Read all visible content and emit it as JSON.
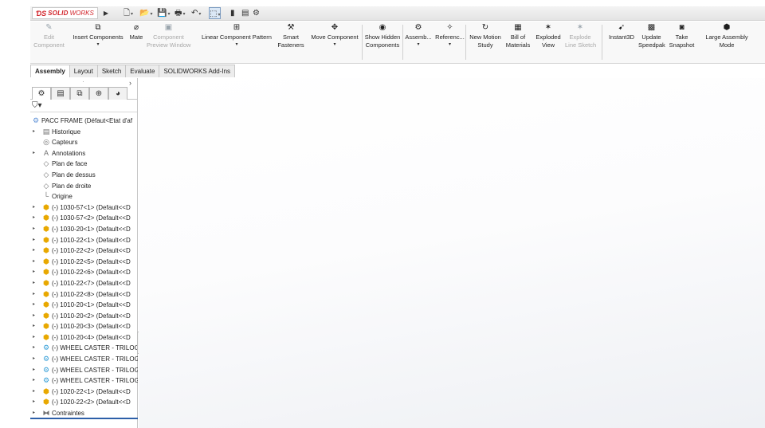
{
  "logo": {
    "ds": "ƊS",
    "sw": "SOLID",
    "works": "WORKS"
  },
  "titlebar": {
    "menu_arrow": "▶",
    "quick_access": [
      {
        "name": "new-document-icon",
        "glyph": "🗋"
      },
      {
        "name": "open-icon",
        "glyph": "📂"
      },
      {
        "name": "save-icon",
        "glyph": "💾"
      },
      {
        "name": "print-icon",
        "glyph": "🖶"
      },
      {
        "name": "undo-icon",
        "glyph": "↶"
      },
      {
        "name": "select-icon",
        "glyph": "⬚"
      },
      {
        "name": "rebuild-icon",
        "glyph": "▮"
      },
      {
        "name": "file-properties-icon",
        "glyph": "▤"
      },
      {
        "name": "options-icon",
        "glyph": "⚙"
      }
    ]
  },
  "commands": [
    {
      "id": "edit-component",
      "lines": [
        "Edit",
        "Component"
      ],
      "icon": "edit-component-icon",
      "glyph": "✎",
      "disabled": true,
      "caret": false
    },
    {
      "id": "insert-components",
      "lines": [
        "Insert Components"
      ],
      "icon": "insert-components-icon",
      "glyph": "⧉",
      "disabled": false,
      "caret": true
    },
    {
      "id": "mate",
      "lines": [
        "Mate"
      ],
      "icon": "mate-icon",
      "glyph": "⌀",
      "disabled": false,
      "caret": false
    },
    {
      "id": "component-preview",
      "lines": [
        "Component",
        "Preview Window"
      ],
      "icon": "component-preview-icon",
      "glyph": "▣",
      "disabled": true,
      "caret": false
    },
    {
      "id": "linear-pattern",
      "lines": [
        "Linear Component Pattern"
      ],
      "icon": "linear-pattern-icon",
      "glyph": "⊞",
      "disabled": false,
      "caret": true
    },
    {
      "id": "smart-fasteners",
      "lines": [
        "Smart",
        "Fasteners"
      ],
      "icon": "smart-fasteners-icon",
      "glyph": "⚒",
      "disabled": false,
      "caret": false
    },
    {
      "id": "move-component",
      "lines": [
        "Move Component"
      ],
      "icon": "move-component-icon",
      "glyph": "✥",
      "disabled": false,
      "caret": true
    },
    {
      "id": "show-hidden",
      "lines": [
        "Show Hidden",
        "Components"
      ],
      "icon": "show-hidden-icon",
      "glyph": "◉",
      "disabled": false,
      "caret": false
    },
    {
      "id": "assembly-features",
      "lines": [
        "Assemb..."
      ],
      "icon": "assembly-features-icon",
      "glyph": "⚙",
      "disabled": false,
      "caret": true
    },
    {
      "id": "reference-geometry",
      "lines": [
        "Referenc..."
      ],
      "icon": "reference-geometry-icon",
      "glyph": "✧",
      "disabled": false,
      "caret": true
    },
    {
      "id": "new-motion-study",
      "lines": [
        "New Motion",
        "Study"
      ],
      "icon": "motion-study-icon",
      "glyph": "↻",
      "disabled": false,
      "caret": false
    },
    {
      "id": "bill-of-materials",
      "lines": [
        "Bill of",
        "Materials"
      ],
      "icon": "bom-icon",
      "glyph": "▦",
      "disabled": false,
      "caret": false
    },
    {
      "id": "exploded-view",
      "lines": [
        "Exploded",
        "View"
      ],
      "icon": "exploded-view-icon",
      "glyph": "✶",
      "disabled": false,
      "caret": false
    },
    {
      "id": "explode-line-sketch",
      "lines": [
        "Explode",
        "Line Sketch"
      ],
      "icon": "explode-line-sketch-icon",
      "glyph": "✶",
      "disabled": true,
      "caret": false
    },
    {
      "id": "instant3d",
      "lines": [
        "Instant3D"
      ],
      "icon": "instant3d-icon",
      "glyph": "➹",
      "disabled": false,
      "caret": false
    },
    {
      "id": "update-speedpak",
      "lines": [
        "Update",
        "Speedpak"
      ],
      "icon": "speedpak-icon",
      "glyph": "▩",
      "disabled": false,
      "caret": false
    },
    {
      "id": "take-snapshot",
      "lines": [
        "Take",
        "Snapshot"
      ],
      "icon": "snapshot-icon",
      "glyph": "◙",
      "disabled": false,
      "caret": false
    },
    {
      "id": "large-assembly-mode",
      "lines": [
        "Large Assembly",
        "Mode"
      ],
      "icon": "large-assembly-icon",
      "glyph": "⬢",
      "disabled": false,
      "caret": false
    }
  ],
  "tabs": [
    {
      "label": "Assembly",
      "active": true
    },
    {
      "label": "Layout",
      "active": false
    },
    {
      "label": "Sketch",
      "active": false
    },
    {
      "label": "Evaluate",
      "active": false
    },
    {
      "label": "SOLIDWORKS Add-Ins",
      "active": false
    }
  ],
  "feature_manager": {
    "grip": "⠂",
    "panel_tabs": [
      {
        "name": "featuremanager-tab",
        "glyph": "⚙",
        "active": true
      },
      {
        "name": "propertymanager-tab",
        "glyph": "▤",
        "active": false
      },
      {
        "name": "configurationmanager-tab",
        "glyph": "⧉",
        "active": false
      },
      {
        "name": "dimxpert-tab",
        "glyph": "⊕",
        "active": false
      },
      {
        "name": "display-manager-tab",
        "glyph": "◕",
        "active": false
      }
    ],
    "more": "›",
    "filter": "⛉▾",
    "tree": [
      {
        "label": "PACC FRAME  (Défaut<Etat d'af",
        "icon": "assembly-icon",
        "glyph": "⚙",
        "cls": "ic-asm",
        "level": 0,
        "expander": false
      },
      {
        "label": "Historique",
        "icon": "history-icon",
        "glyph": "▤",
        "cls": "ic-plane",
        "level": 1,
        "expander": true
      },
      {
        "label": "Capteurs",
        "icon": "sensors-icon",
        "glyph": "◎",
        "cls": "ic-plane",
        "level": 1,
        "expander": false
      },
      {
        "label": "Annotations",
        "icon": "annotations-icon",
        "glyph": "A",
        "cls": "ic-plane",
        "level": 1,
        "expander": true
      },
      {
        "label": "Plan de face",
        "icon": "plane-icon",
        "glyph": "◇",
        "cls": "ic-plane",
        "level": 1,
        "expander": false
      },
      {
        "label": "Plan de dessus",
        "icon": "plane-icon",
        "glyph": "◇",
        "cls": "ic-plane",
        "level": 1,
        "expander": false
      },
      {
        "label": "Plan de droite",
        "icon": "plane-icon",
        "glyph": "◇",
        "cls": "ic-plane",
        "level": 1,
        "expander": false
      },
      {
        "label": "Origine",
        "icon": "origin-icon",
        "glyph": "└",
        "cls": "ic-plane",
        "level": 1,
        "expander": false
      },
      {
        "label": "(-) 1030-57<1> (Default<<D",
        "icon": "part-icon",
        "glyph": "⬢",
        "cls": "ic-part",
        "level": 1,
        "expander": true
      },
      {
        "label": "(-) 1030-57<2> (Default<<D",
        "icon": "part-icon",
        "glyph": "⬢",
        "cls": "ic-part",
        "level": 1,
        "expander": true
      },
      {
        "label": "(-) 1030-20<1> (Default<<D",
        "icon": "part-icon",
        "glyph": "⬢",
        "cls": "ic-part",
        "level": 1,
        "expander": true
      },
      {
        "label": "(-) 1010-22<1> (Default<<D",
        "icon": "part-icon",
        "glyph": "⬢",
        "cls": "ic-part",
        "level": 1,
        "expander": true
      },
      {
        "label": "(-) 1010-22<2> (Default<<D",
        "icon": "part-icon",
        "glyph": "⬢",
        "cls": "ic-part",
        "level": 1,
        "expander": true
      },
      {
        "label": "(-) 1010-22<5> (Default<<D",
        "icon": "part-icon",
        "glyph": "⬢",
        "cls": "ic-part",
        "level": 1,
        "expander": true
      },
      {
        "label": "(-) 1010-22<6> (Default<<D",
        "icon": "part-icon",
        "glyph": "⬢",
        "cls": "ic-part",
        "level": 1,
        "expander": true
      },
      {
        "label": "(-) 1010-22<7> (Default<<D",
        "icon": "part-icon",
        "glyph": "⬢",
        "cls": "ic-part",
        "level": 1,
        "expander": true
      },
      {
        "label": "(-) 1010-22<8> (Default<<D",
        "icon": "part-icon",
        "glyph": "⬢",
        "cls": "ic-part",
        "level": 1,
        "expander": true
      },
      {
        "label": "(-) 1010-20<1> (Default<<D",
        "icon": "part-icon",
        "glyph": "⬢",
        "cls": "ic-part",
        "level": 1,
        "expander": true
      },
      {
        "label": "(-) 1010-20<2> (Default<<D",
        "icon": "part-icon",
        "glyph": "⬢",
        "cls": "ic-part",
        "level": 1,
        "expander": true
      },
      {
        "label": "(-) 1010-20<3> (Default<<D",
        "icon": "part-icon",
        "glyph": "⬢",
        "cls": "ic-part",
        "level": 1,
        "expander": true
      },
      {
        "label": "(-) 1010-20<4> (Default<<D",
        "icon": "part-icon",
        "glyph": "⬢",
        "cls": "ic-part",
        "level": 1,
        "expander": true
      },
      {
        "label": "(-) WHEEL CASTER - TRILOG",
        "icon": "subassembly-icon",
        "glyph": "⚙",
        "cls": "ic-wheel",
        "level": 1,
        "expander": true
      },
      {
        "label": "(-) WHEEL CASTER - TRILOG",
        "icon": "subassembly-icon",
        "glyph": "⚙",
        "cls": "ic-wheel",
        "level": 1,
        "expander": true
      },
      {
        "label": "(-) WHEEL CASTER - TRILOG",
        "icon": "subassembly-icon",
        "glyph": "⚙",
        "cls": "ic-wheel",
        "level": 1,
        "expander": true
      },
      {
        "label": "(-) WHEEL CASTER - TRILOG",
        "icon": "subassembly-icon",
        "glyph": "⚙",
        "cls": "ic-wheel",
        "level": 1,
        "expander": true
      },
      {
        "label": "(-) 1020-22<1> (Default<<D",
        "icon": "part-icon",
        "glyph": "⬢",
        "cls": "ic-part",
        "level": 1,
        "expander": true
      },
      {
        "label": "(-) 1020-22<2> (Default<<D",
        "icon": "part-icon",
        "glyph": "⬢",
        "cls": "ic-part",
        "level": 1,
        "expander": true
      },
      {
        "label": "Contraintes",
        "icon": "mates-icon",
        "glyph": "⧓",
        "cls": "ic-plane",
        "level": 1,
        "expander": true
      }
    ]
  }
}
